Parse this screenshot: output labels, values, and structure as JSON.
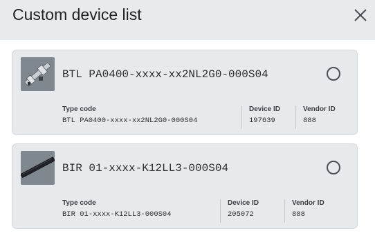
{
  "dialog": {
    "title": "Custom device list",
    "close_icon": "close-icon"
  },
  "devices": [
    {
      "name": "BTL PA0400-xxxx-xx2NL2G0-000S04",
      "thumbnail_icon": "linear-transducer-image",
      "type_code_label": "Type code",
      "type_code": "BTL PA0400-xxxx-xx2NL2G0-000S04",
      "device_id_label": "Device ID",
      "device_id": "197639",
      "vendor_id_label": "Vendor ID",
      "vendor_id": "888",
      "selected": false
    },
    {
      "name": "BIR 01-xxxx-K12LL3-000S04",
      "thumbnail_icon": "profile-sensor-image",
      "type_code_label": "Type code",
      "type_code": "BIR 01-xxxx-K12LL3-000S04",
      "device_id_label": "Device ID",
      "device_id": "205072",
      "vendor_id_label": "Vendor ID",
      "vendor_id": "888",
      "selected": false
    }
  ]
}
